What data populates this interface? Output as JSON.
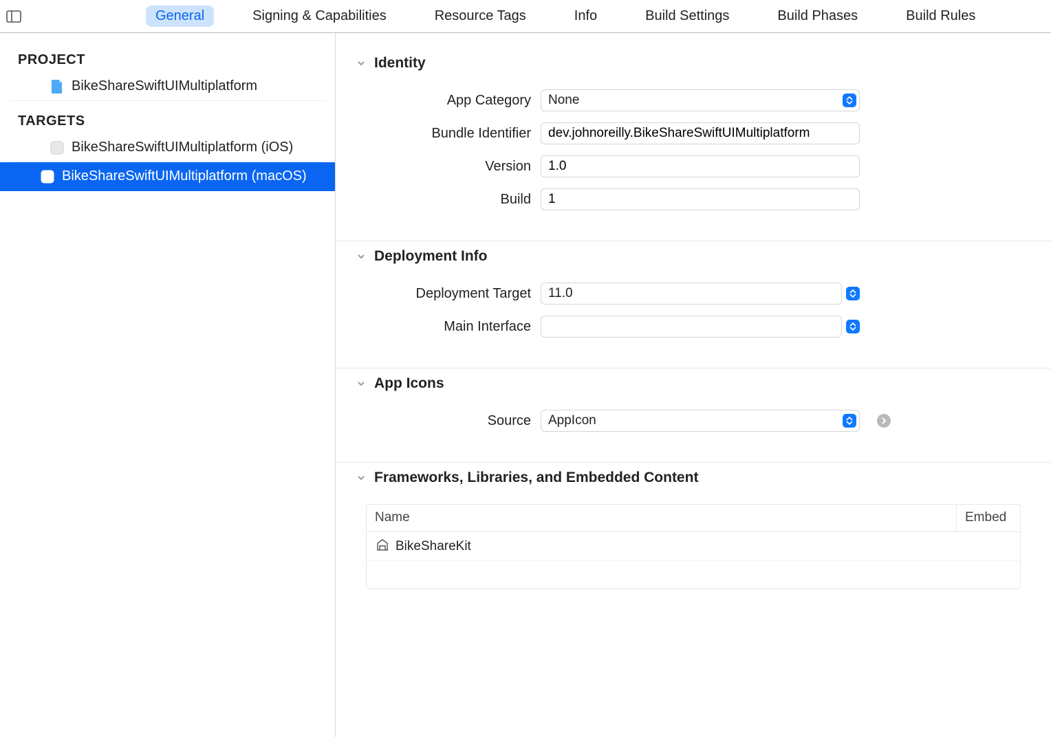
{
  "tabs": [
    "General",
    "Signing & Capabilities",
    "Resource Tags",
    "Info",
    "Build Settings",
    "Build Phases",
    "Build Rules"
  ],
  "activeTab": 0,
  "sidebar": {
    "project_heading": "PROJECT",
    "project_name": "BikeShareSwiftUIMultiplatform",
    "targets_heading": "TARGETS",
    "targets": [
      {
        "label": "BikeShareSwiftUIMultiplatform (iOS)",
        "selected": false
      },
      {
        "label": "BikeShareSwiftUIMultiplatform (macOS)",
        "selected": true
      }
    ]
  },
  "identity": {
    "heading": "Identity",
    "app_category_label": "App Category",
    "app_category_value": "None",
    "bundle_id_label": "Bundle Identifier",
    "bundle_id_value": "dev.johnoreilly.BikeShareSwiftUIMultiplatform",
    "version_label": "Version",
    "version_value": "1.0",
    "build_label": "Build",
    "build_value": "1"
  },
  "deployment": {
    "heading": "Deployment Info",
    "target_label": "Deployment Target",
    "target_value": "11.0",
    "main_interface_label": "Main Interface",
    "main_interface_value": ""
  },
  "appicons": {
    "heading": "App Icons",
    "source_label": "Source",
    "source_value": "AppIcon"
  },
  "frameworks": {
    "heading": "Frameworks, Libraries, and Embedded Content",
    "col_name": "Name",
    "col_embed": "Embed",
    "rows": [
      {
        "name": "BikeShareKit"
      }
    ]
  }
}
